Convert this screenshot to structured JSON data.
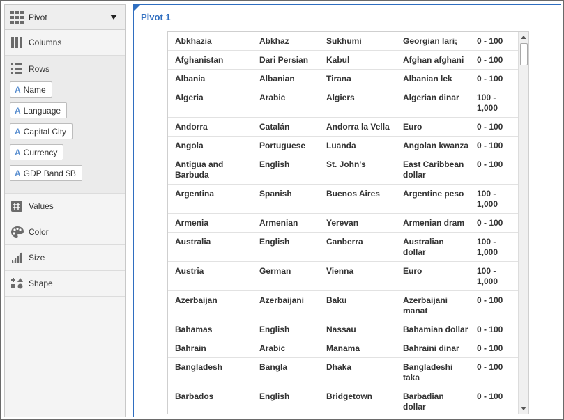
{
  "panel": {
    "header_label": "Pivot",
    "sections": {
      "columns": "Columns",
      "rows": "Rows",
      "values": "Values",
      "color": "Color",
      "size": "Size",
      "shape": "Shape"
    },
    "row_pills": [
      "Name",
      "Language",
      "Capital City",
      "Currency",
      "GDP Band $B"
    ],
    "pill_type_glyph": "A"
  },
  "content": {
    "title": "Pivot 1",
    "rows": [
      [
        "Abkhazia",
        "Abkhaz",
        "Sukhumi",
        "Georgian lari;",
        "0 - 100"
      ],
      [
        "Afghanistan",
        "Dari Persian",
        "Kabul",
        "Afghan afghani",
        "0 - 100"
      ],
      [
        "Albania",
        "Albanian",
        "Tirana",
        "Albanian lek",
        "0 - 100"
      ],
      [
        "Algeria",
        "Arabic",
        "Algiers",
        "Algerian dinar",
        "100 - 1,000"
      ],
      [
        "Andorra",
        "Catalán",
        "Andorra la Vella",
        "Euro",
        "0 - 100"
      ],
      [
        "Angola",
        "Portuguese",
        "Luanda",
        "Angolan kwanza",
        "0 - 100"
      ],
      [
        "Antigua and Barbuda",
        "English",
        "St. John's",
        "East Caribbean dollar",
        "0 - 100"
      ],
      [
        "Argentina",
        "Spanish",
        "Buenos Aires",
        "Argentine peso",
        "100 - 1,000"
      ],
      [
        "Armenia",
        "Armenian",
        "Yerevan",
        "Armenian dram",
        "0 - 100"
      ],
      [
        "Australia",
        "English",
        "Canberra",
        "Australian dollar",
        "100 - 1,000"
      ],
      [
        "Austria",
        "German",
        "Vienna",
        "Euro",
        "100 - 1,000"
      ],
      [
        "Azerbaijan",
        "Azerbaijani",
        "Baku",
        "Azerbaijani manat",
        "0 - 100"
      ],
      [
        "Bahamas",
        "English",
        "Nassau",
        "Bahamian dollar",
        "0 - 100"
      ],
      [
        "Bahrain",
        "Arabic",
        "Manama",
        "Bahraini dinar",
        "0 - 100"
      ],
      [
        "Bangladesh",
        "Bangla",
        "Dhaka",
        "Bangladeshi taka",
        "0 - 100"
      ],
      [
        "Barbados",
        "English",
        "Bridgetown",
        "Barbadian dollar",
        "0 - 100"
      ]
    ]
  },
  "colors": {
    "accent": "#2f6ec0",
    "icon": "#6b6b6b"
  }
}
